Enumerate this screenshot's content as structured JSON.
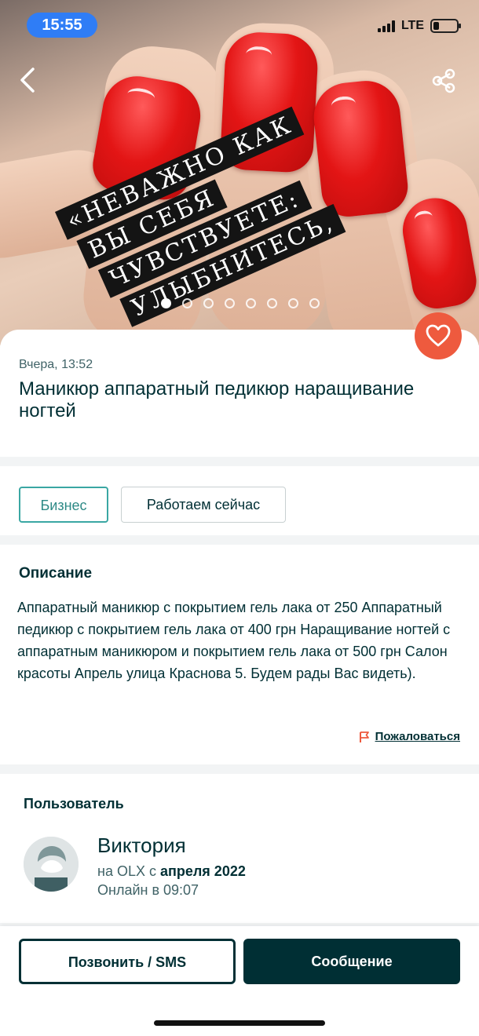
{
  "status_bar": {
    "time": "15:55",
    "network": "LTE"
  },
  "hero": {
    "quote_lines": [
      "«НЕВАЖНО КАК",
      "ВЫ СЕБЯ",
      "ЧУВСТВУЕТЕ:",
      "УЛЫБНИТЕСЬ,"
    ],
    "photo_count": 8,
    "active_photo": 1
  },
  "listing": {
    "date": "Вчера, 13:52",
    "title": "Маникюр аппаратный педикюр наращивание ногтей"
  },
  "badges": {
    "business": "Бизнес",
    "working_now": "Работаем сейчас"
  },
  "description": {
    "heading": "Описание",
    "text": "Аппаратный маникюр с покрытием гель лака от 250 Аппаратный педикюр с покрытием гель лака от 400 грн Наращивание ногтей с аппаратным маникюром и покрытием гель лака от 500 грн Салон красоты Апрель улица Краснова 5. Будем рады Вас видеть).",
    "report_label": "Пожаловаться"
  },
  "user": {
    "heading": "Пользователь",
    "name": "Виктория",
    "since_prefix": "на OLX с ",
    "since_date": "апреля 2022",
    "online": "Онлайн в 09:07"
  },
  "actions": {
    "call": "Позвонить / SMS",
    "message": "Сообщение"
  },
  "colors": {
    "primary": "#002f34",
    "accent": "#ee5a3e",
    "business_badge": "#3aa7a3"
  }
}
